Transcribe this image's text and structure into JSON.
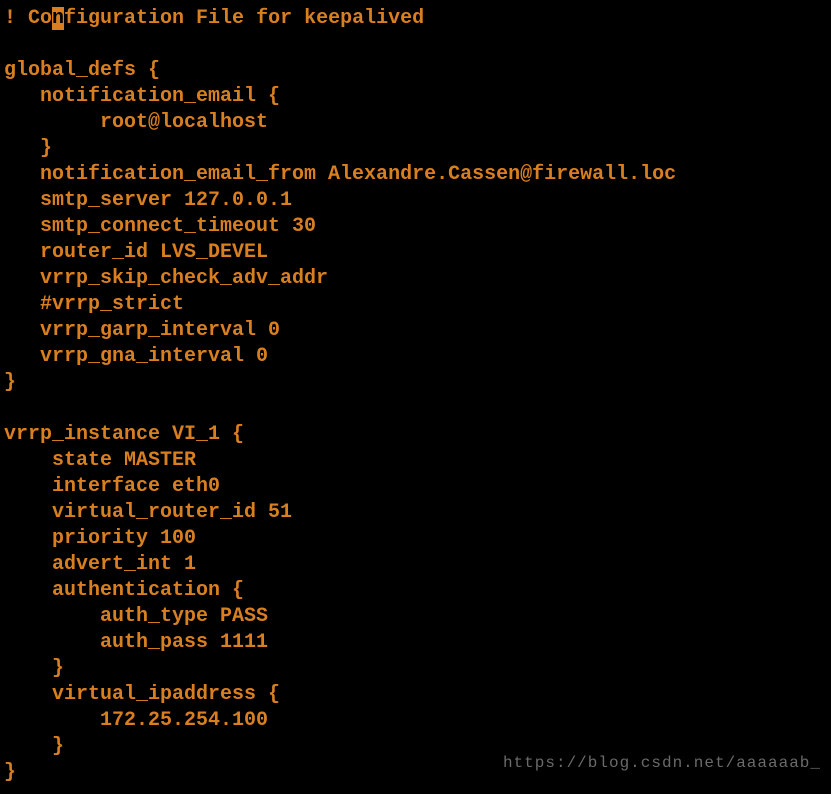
{
  "config": {
    "line01_pre": "! Co",
    "line01_cursor": "n",
    "line01_post": "figuration File for keepalived",
    "line02": "",
    "line03": "global_defs {",
    "line04": "   notification_email {",
    "line05": "        root@localhost",
    "line06": "   }",
    "line07": "   notification_email_from Alexandre.Cassen@firewall.loc",
    "line08": "   smtp_server 127.0.0.1",
    "line09": "   smtp_connect_timeout 30",
    "line10": "   router_id LVS_DEVEL",
    "line11": "   vrrp_skip_check_adv_addr",
    "line12": "   #vrrp_strict",
    "line13": "   vrrp_garp_interval 0",
    "line14": "   vrrp_gna_interval 0",
    "line15": "}",
    "line16": "",
    "line17": "vrrp_instance VI_1 {",
    "line18": "    state MASTER",
    "line19": "    interface eth0",
    "line20": "    virtual_router_id 51",
    "line21": "    priority 100",
    "line22": "    advert_int 1",
    "line23": "    authentication {",
    "line24": "        auth_type PASS",
    "line25": "        auth_pass 1111",
    "line26": "    }",
    "line27": "    virtual_ipaddress {",
    "line28": "        172.25.254.100",
    "line29": "    }",
    "line30": "}"
  },
  "watermark": "https://blog.csdn.net/aaaaaab_"
}
